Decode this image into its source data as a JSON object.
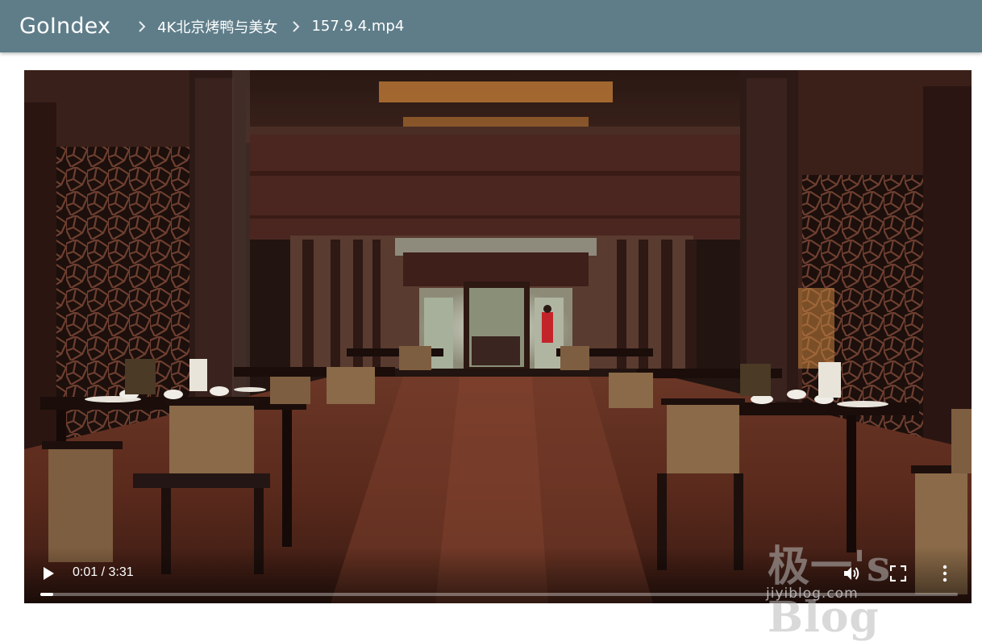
{
  "app": {
    "title": "GoIndex"
  },
  "breadcrumb": [
    {
      "label": "4K北京烤鸭与美女"
    },
    {
      "label": "157.9.4.mp4"
    }
  ],
  "player": {
    "current_time": "0:01",
    "duration": "3:31",
    "time_display": "0:01 / 3:31",
    "progress_fraction": 0.005,
    "buttons": [
      "play-icon",
      "volume-icon",
      "fullscreen-icon",
      "more-options-icon"
    ]
  },
  "watermark": {
    "main": "极一's Blog",
    "sub": "jiyiblog.com"
  },
  "colors": {
    "topbar": "#5f7d89",
    "player_bg": "#1a0f0c",
    "text": "#ffffff"
  }
}
